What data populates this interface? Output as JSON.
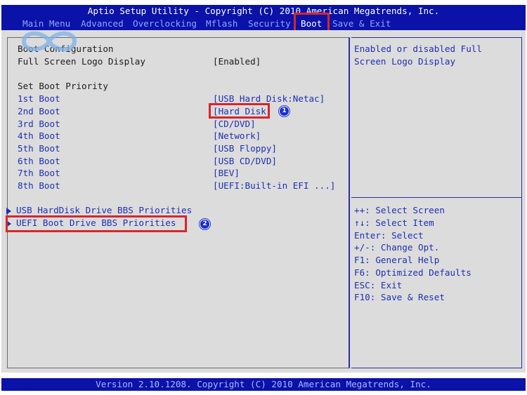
{
  "title": "Aptio Setup Utility - Copyright (C) 2010 American Megatrends, Inc.",
  "menu": {
    "tabs": [
      {
        "label": "Main Menu"
      },
      {
        "label": "Advanced"
      },
      {
        "label": "Overclocking"
      },
      {
        "label": "Mflash"
      },
      {
        "label": "Security"
      },
      {
        "label": "Boot"
      },
      {
        "label": "Save & Exit"
      }
    ],
    "active": "Boot"
  },
  "settings": {
    "boot_configuration": "Boot Configuration",
    "fullscreen_logo_label": "Full Screen Logo Display",
    "fullscreen_logo_value": "[Enabled]",
    "set_boot_priority": "Set Boot Priority",
    "boot_order": [
      {
        "label": "1st Boot",
        "value": "[USB Hard Disk:Netac]"
      },
      {
        "label": "2nd Boot",
        "value": "[Hard Disk]"
      },
      {
        "label": "3rd Boot",
        "value": "[CD/DVD]"
      },
      {
        "label": "4th Boot",
        "value": "[Network]"
      },
      {
        "label": "5th Boot",
        "value": "[USB Floppy]"
      },
      {
        "label": "6th Boot",
        "value": "[USB CD/DVD]"
      },
      {
        "label": "7th Boot",
        "value": "[BEV]"
      },
      {
        "label": "8th Boot",
        "value": "[UEFI:Built-in EFI ...]"
      }
    ],
    "submenus": [
      {
        "label": "USB HardDisk Drive BBS Priorities"
      },
      {
        "label": "UEFI Boot Drive BBS Priorities"
      }
    ]
  },
  "help": {
    "description_line1": "Enabled or disabled Full",
    "description_line2": "Screen Logo Display",
    "keys": [
      "++: Select Screen",
      "↑↓: Select Item",
      "Enter: Select",
      "+/-: Change Opt.",
      "F1: General Help",
      "F6: Optimized Defaults",
      "ESC: Exit",
      "F10: Save & Reset"
    ]
  },
  "annotations": {
    "badge1": "1",
    "badge2": "2"
  },
  "footer": "Version 2.10.1208. Copyright (C) 2010 American Megatrends, Inc.",
  "colors": {
    "bios_blue": "#0a12a8",
    "panel_gray": "#dcdcdc",
    "highlight_red": "#d7262b",
    "badge_blue": "#1b2fd0"
  },
  "icons": {
    "watermark": "infinity-logo"
  }
}
